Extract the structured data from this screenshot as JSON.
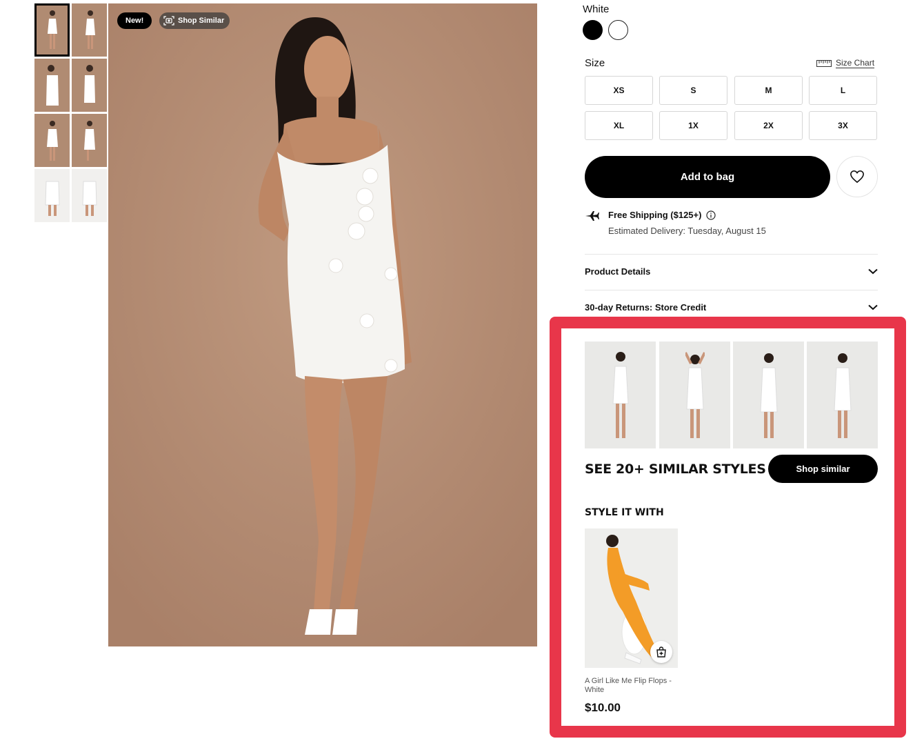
{
  "product": {
    "color_label": "White",
    "swatches": [
      {
        "name": "Black",
        "hex": "#000000"
      },
      {
        "name": "White",
        "hex": "#ffffff"
      }
    ],
    "badge_new": "New!",
    "badge_shop_similar": "Shop Similar"
  },
  "size": {
    "label": "Size",
    "chart_link": "Size Chart",
    "options": [
      "XS",
      "S",
      "M",
      "L",
      "XL",
      "1X",
      "2X",
      "3X"
    ]
  },
  "actions": {
    "add_to_bag": "Add to bag"
  },
  "shipping": {
    "title": "Free Shipping ($125+)",
    "estimate": "Estimated Delivery: Tuesday, August 15"
  },
  "accordions": [
    {
      "label": "Product Details"
    },
    {
      "label": "30-day Returns: Store Credit"
    }
  ],
  "similar": {
    "title": "SEE 20+ SIMILAR STYLES",
    "button": "Shop similar"
  },
  "style_it_with": {
    "title": "STYLE IT WITH",
    "items": [
      {
        "name": "A Girl Like Me Flip Flops - White",
        "price": "$10.00"
      }
    ]
  },
  "colors": {
    "highlight": "#e8364a",
    "photo_background": "#b58d74",
    "accent": "#000000"
  }
}
